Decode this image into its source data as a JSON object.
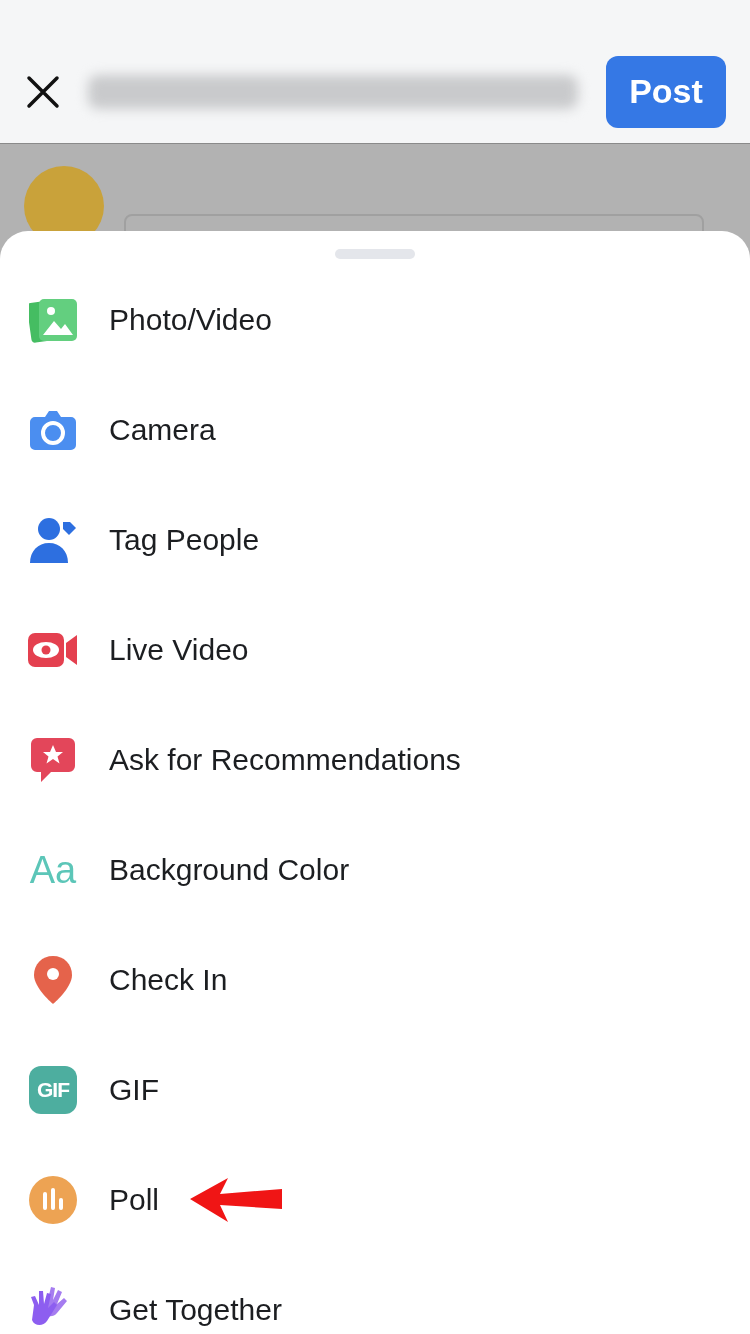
{
  "header": {
    "post_button": "Post"
  },
  "options": [
    {
      "kind": "photo",
      "label": "Photo/Video",
      "annotated": false
    },
    {
      "kind": "camera",
      "label": "Camera",
      "annotated": false
    },
    {
      "kind": "tag",
      "label": "Tag People",
      "annotated": false
    },
    {
      "kind": "live",
      "label": "Live Video",
      "annotated": false
    },
    {
      "kind": "recommend",
      "label": "Ask for Recommendations",
      "annotated": false
    },
    {
      "kind": "background",
      "label": "Background Color",
      "icon_text": "Aa",
      "annotated": false
    },
    {
      "kind": "checkin",
      "label": "Check In",
      "annotated": false
    },
    {
      "kind": "gif",
      "label": "GIF",
      "icon_text": "GIF",
      "annotated": false
    },
    {
      "kind": "poll",
      "label": "Poll",
      "annotated": true
    },
    {
      "kind": "together",
      "label": "Get Together",
      "annotated": false
    }
  ]
}
